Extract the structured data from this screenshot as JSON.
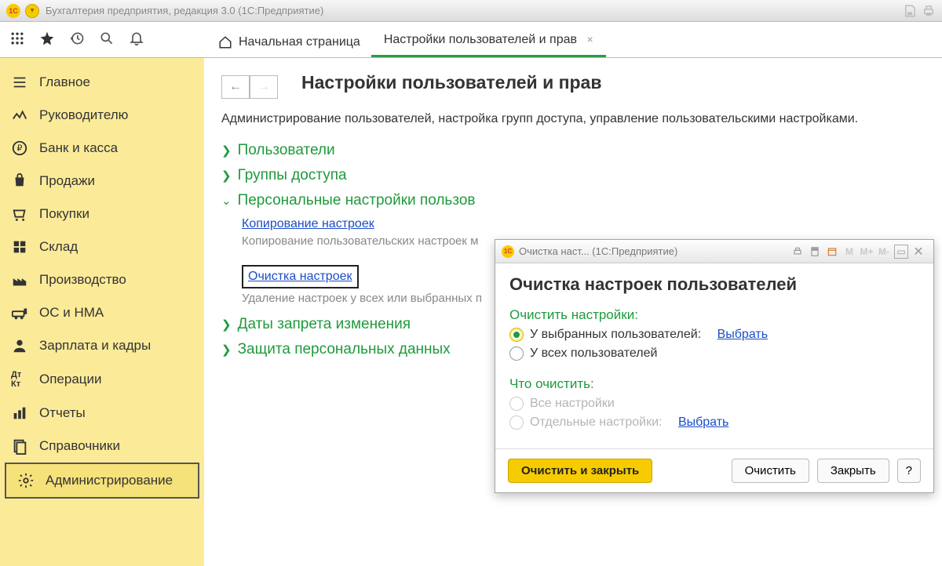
{
  "titlebar": {
    "app_title": "Бухгалтерия предприятия, редакция 3.0  (1С:Предприятие)"
  },
  "tabs": {
    "home": "Начальная страница",
    "current": "Настройки пользователей и прав"
  },
  "sidebar": {
    "items": [
      "Главное",
      "Руководителю",
      "Банк и касса",
      "Продажи",
      "Покупки",
      "Склад",
      "Производство",
      "ОС и НМА",
      "Зарплата и кадры",
      "Операции",
      "Отчеты",
      "Справочники",
      "Администрирование"
    ]
  },
  "page": {
    "title": "Настройки пользователей и прав",
    "desc": "Администрирование пользователей, настройка групп доступа, управление пользовательскими настройками.",
    "sec_users": "Пользователи",
    "sec_groups": "Группы доступа",
    "sec_personal": "Персональные настройки пользов",
    "copy_link": "Копирование настроек",
    "copy_desc": "Копирование пользовательских настроек м",
    "clear_link": "Очистка настроек",
    "clear_desc": "Удаление настроек у всех или выбранных п",
    "sec_dates": "Даты запрета изменения",
    "sec_protect": "Защита персональных данных"
  },
  "dialog": {
    "win_title": "Очистка наст... (1С:Предприятие)",
    "toolbar_m": [
      "M",
      "M+",
      "M-"
    ],
    "heading": "Очистка настроек пользователей",
    "group1": "Очистить настройки:",
    "opt_selected_users": "У выбранных пользователей:",
    "select_link": "Выбрать",
    "opt_all_users": "У всех пользователей",
    "group2": "Что очистить:",
    "opt_all_settings": "Все настройки",
    "opt_some_settings": "Отдельные настройки:",
    "select_link2": "Выбрать",
    "btn_primary": "Очистить и закрыть",
    "btn_clear": "Очистить",
    "btn_close": "Закрыть",
    "btn_help": "?"
  }
}
